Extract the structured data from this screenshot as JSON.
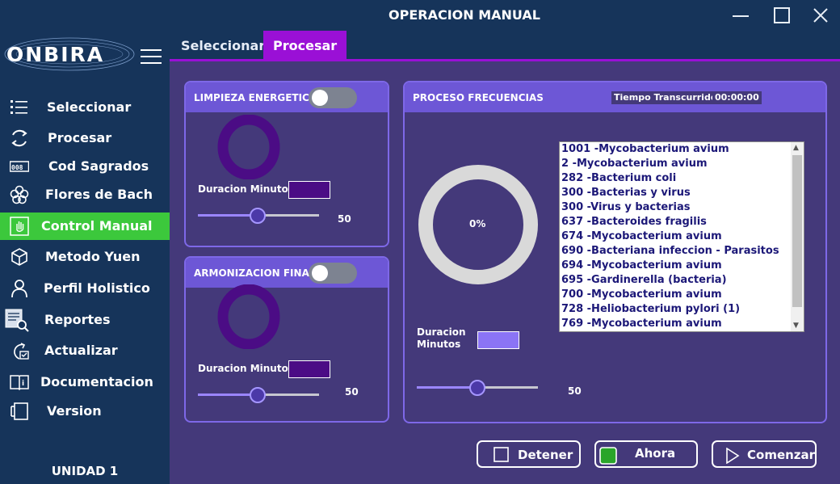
{
  "window": {
    "title": "OPERACION MANUAL"
  },
  "sidebar": {
    "logo_text": "ONBIRA",
    "items": [
      {
        "label": "Seleccionar",
        "icon": "list-icon"
      },
      {
        "label": "Procesar",
        "icon": "refresh-icon"
      },
      {
        "label": "Cod Sagrados",
        "icon": "counter-icon"
      },
      {
        "label": "Flores de Bach",
        "icon": "flower-icon"
      },
      {
        "label": "Control Manual",
        "icon": "hand-icon"
      },
      {
        "label": "Metodo Yuen",
        "icon": "cube-icon"
      },
      {
        "label": "Perfil Holistico",
        "icon": "user-icon"
      },
      {
        "label": "Reportes",
        "icon": "report-search-icon"
      },
      {
        "label": "Actualizar",
        "icon": "update-icon"
      },
      {
        "label": "Documentacion",
        "icon": "book-info-icon"
      },
      {
        "label": "Version",
        "icon": "device-icon"
      }
    ],
    "active_item": "Control Manual",
    "unit_label": "UNIDAD 1"
  },
  "tabs": [
    {
      "label": "Seleccionar",
      "active": false
    },
    {
      "label": "Procesar",
      "active": true
    }
  ],
  "limpieza": {
    "title": "LIMPIEZA ENERGETICA",
    "toggle_on": false,
    "duration_label": "Duracion Minutos",
    "value": "50",
    "slider_fraction": 0.49
  },
  "armonizacion": {
    "title": "ARMONIZACION FINAL",
    "toggle_on": false,
    "duration_label": "Duracion Minutos",
    "value": "50",
    "slider_fraction": 0.49
  },
  "proceso": {
    "title": "PROCESO FRECUENCIAS",
    "time_label": "Tiempo Transcurrido",
    "time_value": "00:00:00",
    "progress_text": "0%",
    "progress": 0,
    "duration_label_1": "Duracion",
    "duration_label_2": "Minutos",
    "value": "50",
    "slider_fraction": 0.5,
    "frequencies": [
      "1001 -Mycobacterium avium",
      "2 -Mycobacterium avium",
      "282 -Bacterium coli",
      "300 -Bacterias y virus",
      "300 -Virus y bacterias",
      "637 -Bacteroides fragilis",
      "674 -Mycobacterium avium",
      "690 -Bacteriana infeccion - Parasitos",
      "694 -Mycobacterium avium",
      "695 -Gardinerella (bacteria)",
      "700 -Mycobacterium avium",
      "728 -Heliobacterium pylori (1)",
      "769 -Mycobacterium avium"
    ]
  },
  "buttons": {
    "stop": "Detener",
    "now": "Ahora",
    "start": "Comenzar"
  },
  "colors": {
    "accent_purple": "#9a10d6",
    "active_green": "#3cc83c",
    "panel_header": "#6d57d6",
    "ring_dark": "#4b0c85"
  }
}
